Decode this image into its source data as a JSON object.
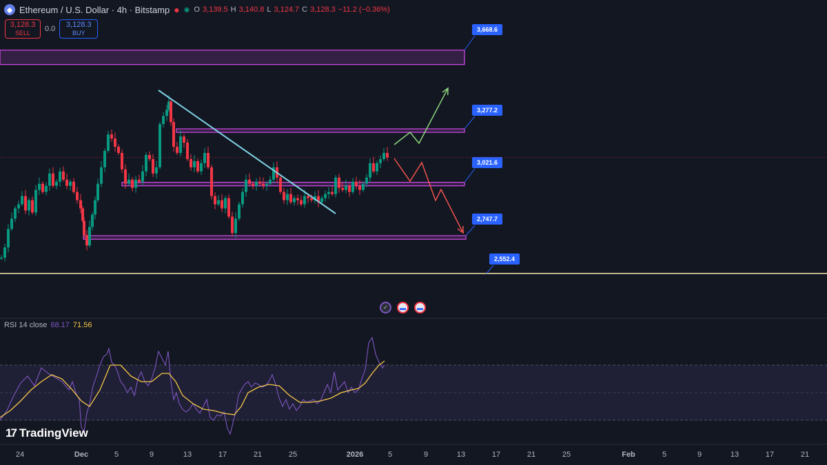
{
  "header": {
    "symbol": "Ethereum / U.S. Dollar · 4h · Bitstamp",
    "open_label": "O",
    "open": "3,139.5",
    "high_label": "H",
    "high": "3,140.8",
    "low_label": "L",
    "low": "3,124.7",
    "close_label": "C",
    "close": "3,128.3",
    "change": "−11.2 (−0.36%)"
  },
  "trade": {
    "sell_price": "3,128.3",
    "sell_label": "SELL",
    "spread": "0.0",
    "buy_price": "3,128.3",
    "buy_label": "BUY"
  },
  "rsi": {
    "label": "RSI 14 close",
    "value1": "68.17",
    "value2": "71.56"
  },
  "brand": {
    "name": "TradingView"
  },
  "colors": {
    "background": "#131722",
    "bull": "#089981",
    "bear": "#f23645",
    "zone": "#d24be8",
    "trendline": "#7fd3e6",
    "support": "#f5e6a8",
    "rsi": "#7e57c2",
    "rsi_ma": "#f7c948",
    "label": "#2962ff",
    "arrow_up": "#8ed57e",
    "arrow_down": "#f0534d"
  },
  "chart_data": {
    "type": "candlestick",
    "x_ticks": [
      "24",
      "Dec",
      "5",
      "9",
      "13",
      "17",
      "21",
      "25",
      "2026",
      "5",
      "9",
      "13",
      "17",
      "21",
      "25",
      "Feb",
      "5",
      "9",
      "13",
      "17",
      "21"
    ],
    "current_price": 3128.3,
    "price_path": [
      [
        0,
        2640
      ],
      [
        5,
        2690
      ],
      [
        10,
        2780
      ],
      [
        15,
        2830
      ],
      [
        20,
        2880
      ],
      [
        25,
        2900
      ],
      [
        30,
        2940
      ],
      [
        35,
        2870
      ],
      [
        40,
        2920
      ],
      [
        45,
        2860
      ],
      [
        50,
        2970
      ],
      [
        55,
        3000
      ],
      [
        60,
        2960
      ],
      [
        65,
        2990
      ],
      [
        70,
        3050
      ],
      [
        75,
        2990
      ],
      [
        80,
        3010
      ],
      [
        85,
        3060
      ],
      [
        90,
        3020
      ],
      [
        95,
        2990
      ],
      [
        100,
        3010
      ],
      [
        105,
        2960
      ],
      [
        110,
        2920
      ],
      [
        115,
        2880
      ],
      [
        118,
        2820
      ],
      [
        120,
        2750
      ],
      [
        124,
        2700
      ],
      [
        128,
        2790
      ],
      [
        132,
        2850
      ],
      [
        136,
        2920
      ],
      [
        140,
        3000
      ],
      [
        145,
        3080
      ],
      [
        150,
        3160
      ],
      [
        155,
        3240
      ],
      [
        160,
        3220
      ],
      [
        165,
        3180
      ],
      [
        170,
        3150
      ],
      [
        175,
        3070
      ],
      [
        180,
        3000
      ],
      [
        185,
        3020
      ],
      [
        190,
        2980
      ],
      [
        195,
        3020
      ],
      [
        200,
        3010
      ],
      [
        205,
        3060
      ],
      [
        210,
        3140
      ],
      [
        215,
        3120
      ],
      [
        220,
        3050
      ],
      [
        225,
        3080
      ],
      [
        230,
        3290
      ],
      [
        235,
        3330
      ],
      [
        240,
        3360
      ],
      [
        243,
        3400
      ],
      [
        246,
        3300
      ],
      [
        250,
        3180
      ],
      [
        255,
        3150
      ],
      [
        260,
        3230
      ],
      [
        265,
        3200
      ],
      [
        270,
        3120
      ],
      [
        275,
        3080
      ],
      [
        280,
        3110
      ],
      [
        285,
        3060
      ],
      [
        290,
        3100
      ],
      [
        295,
        3150
      ],
      [
        300,
        3080
      ],
      [
        305,
        2940
      ],
      [
        310,
        2900
      ],
      [
        315,
        2920
      ],
      [
        320,
        2880
      ],
      [
        325,
        2930
      ],
      [
        330,
        2840
      ],
      [
        335,
        2760
      ],
      [
        340,
        2830
      ],
      [
        345,
        2900
      ],
      [
        350,
        2960
      ],
      [
        355,
        3020
      ],
      [
        360,
        3000
      ],
      [
        365,
        2990
      ],
      [
        370,
        3010
      ],
      [
        375,
        3000
      ],
      [
        380,
        2990
      ],
      [
        385,
        3000
      ],
      [
        390,
        3020
      ],
      [
        395,
        3080
      ],
      [
        400,
        3030
      ],
      [
        405,
        2960
      ],
      [
        410,
        2920
      ],
      [
        415,
        2950
      ],
      [
        420,
        2910
      ],
      [
        425,
        2930
      ],
      [
        430,
        2920
      ],
      [
        435,
        2900
      ],
      [
        440,
        2940
      ],
      [
        445,
        2930
      ],
      [
        450,
        2920
      ],
      [
        455,
        2940
      ],
      [
        460,
        2910
      ],
      [
        465,
        2930
      ],
      [
        470,
        2950
      ],
      [
        475,
        2960
      ],
      [
        480,
        2950
      ],
      [
        485,
        3030
      ],
      [
        490,
        2980
      ],
      [
        495,
        2970
      ],
      [
        500,
        2990
      ],
      [
        505,
        2960
      ],
      [
        510,
        3010
      ],
      [
        515,
        2990
      ],
      [
        520,
        2970
      ],
      [
        525,
        3000
      ],
      [
        530,
        3030
      ],
      [
        535,
        3100
      ],
      [
        540,
        3060
      ],
      [
        545,
        3100
      ],
      [
        550,
        3120
      ],
      [
        555,
        3150
      ],
      [
        560,
        3128
      ]
    ],
    "zones": [
      {
        "label": "3,668.6",
        "low": 3580,
        "high": 3650
      },
      {
        "label": "3,277.2",
        "low": 3250,
        "high": 3267
      },
      {
        "label": "3,021.6",
        "low": 2990,
        "high": 3007
      },
      {
        "label": "2,747.7",
        "low": 2730,
        "high": 2747
      }
    ],
    "support_line": {
      "label": "2,552.4",
      "price": 2552.4
    },
    "rsi_path": [
      [
        0,
        30
      ],
      [
        10,
        37
      ],
      [
        20,
        48
      ],
      [
        30,
        57
      ],
      [
        40,
        62
      ],
      [
        50,
        55
      ],
      [
        60,
        68
      ],
      [
        70,
        64
      ],
      [
        80,
        61
      ],
      [
        90,
        58
      ],
      [
        95,
        55
      ],
      [
        100,
        52
      ],
      [
        105,
        58
      ],
      [
        110,
        50
      ],
      [
        115,
        45
      ],
      [
        118,
        25
      ],
      [
        122,
        22
      ],
      [
        126,
        35
      ],
      [
        130,
        42
      ],
      [
        135,
        55
      ],
      [
        140,
        62
      ],
      [
        145,
        70
      ],
      [
        150,
        76
      ],
      [
        155,
        78
      ],
      [
        158,
        82
      ],
      [
        162,
        72
      ],
      [
        166,
        70
      ],
      [
        170,
        66
      ],
      [
        175,
        58
      ],
      [
        180,
        55
      ],
      [
        185,
        50
      ],
      [
        190,
        54
      ],
      [
        195,
        48
      ],
      [
        200,
        60
      ],
      [
        205,
        65
      ],
      [
        210,
        58
      ],
      [
        215,
        55
      ],
      [
        220,
        60
      ],
      [
        225,
        68
      ],
      [
        230,
        80
      ],
      [
        235,
        75
      ],
      [
        240,
        70
      ],
      [
        244,
        80
      ],
      [
        248,
        58
      ],
      [
        252,
        45
      ],
      [
        256,
        50
      ],
      [
        260,
        42
      ],
      [
        265,
        38
      ],
      [
        270,
        36
      ],
      [
        275,
        38
      ],
      [
        280,
        42
      ],
      [
        285,
        38
      ],
      [
        290,
        35
      ],
      [
        295,
        40
      ],
      [
        300,
        45
      ],
      [
        305,
        32
      ],
      [
        310,
        30
      ],
      [
        315,
        34
      ],
      [
        320,
        33
      ],
      [
        325,
        36
      ],
      [
        330,
        24
      ],
      [
        334,
        20
      ],
      [
        338,
        28
      ],
      [
        342,
        36
      ],
      [
        346,
        48
      ],
      [
        350,
        52
      ],
      [
        355,
        56
      ],
      [
        360,
        58
      ],
      [
        365,
        54
      ],
      [
        370,
        57
      ],
      [
        375,
        56
      ],
      [
        380,
        54
      ],
      [
        385,
        55
      ],
      [
        390,
        58
      ],
      [
        395,
        63
      ],
      [
        400,
        56
      ],
      [
        405,
        46
      ],
      [
        410,
        40
      ],
      [
        415,
        45
      ],
      [
        420,
        38
      ],
      [
        425,
        42
      ],
      [
        430,
        37
      ],
      [
        435,
        40
      ],
      [
        440,
        45
      ],
      [
        445,
        43
      ],
      [
        450,
        44
      ],
      [
        455,
        45
      ],
      [
        460,
        42
      ],
      [
        465,
        44
      ],
      [
        470,
        50
      ],
      [
        475,
        56
      ],
      [
        480,
        50
      ],
      [
        485,
        65
      ],
      [
        490,
        52
      ],
      [
        495,
        55
      ],
      [
        500,
        58
      ],
      [
        505,
        50
      ],
      [
        510,
        54
      ],
      [
        515,
        50
      ],
      [
        520,
        52
      ],
      [
        525,
        60
      ],
      [
        530,
        67
      ],
      [
        535,
        86
      ],
      [
        540,
        90
      ],
      [
        545,
        78
      ],
      [
        550,
        72
      ],
      [
        555,
        68
      ],
      [
        558,
        70
      ]
    ],
    "rsi_ma_path": [
      [
        0,
        32
      ],
      [
        15,
        37
      ],
      [
        30,
        44
      ],
      [
        45,
        52
      ],
      [
        60,
        58
      ],
      [
        75,
        63
      ],
      [
        90,
        60
      ],
      [
        105,
        52
      ],
      [
        118,
        44
      ],
      [
        130,
        40
      ],
      [
        145,
        52
      ],
      [
        160,
        70
      ],
      [
        175,
        70
      ],
      [
        190,
        62
      ],
      [
        205,
        58
      ],
      [
        220,
        58
      ],
      [
        235,
        64
      ],
      [
        245,
        64
      ],
      [
        255,
        58
      ],
      [
        265,
        48
      ],
      [
        280,
        42
      ],
      [
        295,
        38
      ],
      [
        310,
        37
      ],
      [
        325,
        35
      ],
      [
        340,
        34
      ],
      [
        350,
        40
      ],
      [
        360,
        50
      ],
      [
        375,
        54
      ],
      [
        390,
        56
      ],
      [
        405,
        55
      ],
      [
        420,
        48
      ],
      [
        435,
        43
      ],
      [
        450,
        43
      ],
      [
        465,
        44
      ],
      [
        480,
        46
      ],
      [
        495,
        50
      ],
      [
        510,
        52
      ],
      [
        520,
        53
      ],
      [
        530,
        57
      ],
      [
        540,
        64
      ],
      [
        550,
        70
      ],
      [
        558,
        73
      ]
    ],
    "rsi_range": [
      0,
      100
    ],
    "rsi_bands": [
      30,
      50,
      70
    ],
    "forecast_up": [
      [
        572,
        210
      ],
      [
        595,
        192
      ],
      [
        608,
        208
      ],
      [
        650,
        128
      ]
    ],
    "forecast_down": [
      [
        572,
        230
      ],
      [
        595,
        263
      ],
      [
        612,
        236
      ],
      [
        632,
        291
      ],
      [
        640,
        275
      ],
      [
        672,
        338
      ]
    ],
    "trendline": [
      [
        230,
        131
      ],
      [
        487,
        310
      ]
    ],
    "grid": false
  }
}
